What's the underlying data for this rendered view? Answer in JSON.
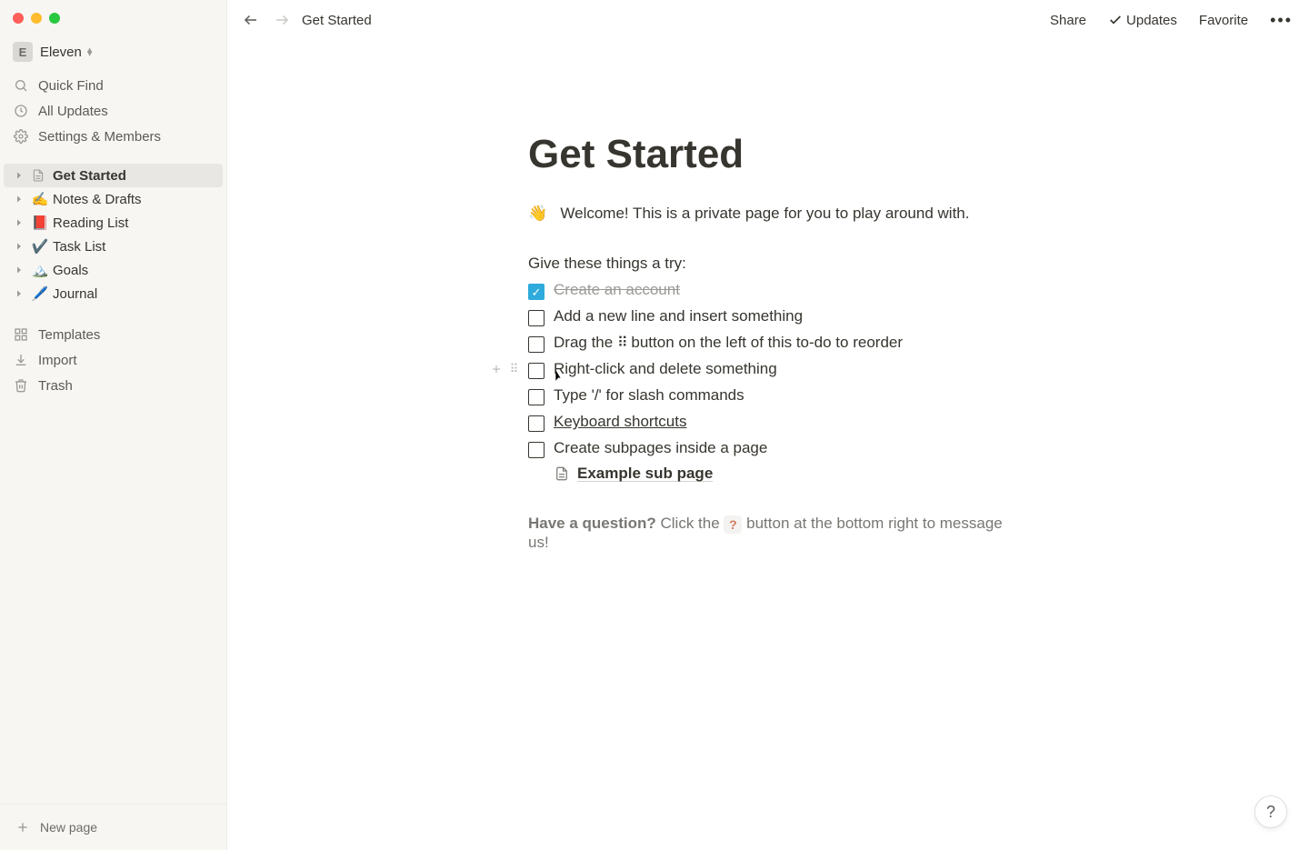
{
  "workspace": {
    "avatar_initial": "E",
    "name": "Eleven"
  },
  "nav": {
    "quick_find": "Quick Find",
    "all_updates": "All Updates",
    "settings_members": "Settings & Members",
    "templates": "Templates",
    "import": "Import",
    "trash": "Trash",
    "new_page": "New page"
  },
  "pages": [
    {
      "icon": "📄",
      "label": "Get Started",
      "active": true,
      "icon_type": "page"
    },
    {
      "icon": "✍️",
      "label": "Notes & Drafts"
    },
    {
      "icon": "📕",
      "label": "Reading List"
    },
    {
      "icon": "✔️",
      "label": "Task List"
    },
    {
      "icon": "🏔️",
      "label": "Goals"
    },
    {
      "icon": "🖊️",
      "label": "Journal"
    }
  ],
  "topbar": {
    "breadcrumb": "Get Started",
    "share": "Share",
    "updates": "Updates",
    "favorite": "Favorite"
  },
  "page": {
    "title": "Get Started",
    "welcome_emoji": "👋",
    "welcome_text": "Welcome! This is a private page for you to play around with.",
    "try_heading": "Give these things a try:",
    "todos": [
      {
        "text": "Create an account",
        "checked": true
      },
      {
        "text": "Add a new line and insert something",
        "checked": false
      },
      {
        "text_pre": "Drag the ",
        "handle": "⠿",
        "text_post": " button on the left of this to-do to reorder",
        "checked": false
      },
      {
        "text": "Right-click and delete something",
        "checked": false,
        "hovered": true
      },
      {
        "text": "Type '/' for slash commands",
        "checked": false
      },
      {
        "text": "Keyboard shortcuts",
        "checked": false,
        "underline": true
      },
      {
        "text": "Create subpages inside a page",
        "checked": false
      }
    ],
    "subpage": {
      "label": "Example sub page"
    },
    "footer": {
      "q_label": "Have a question?",
      "pre": " Click the ",
      "chip": "?",
      "post": " button at the bottom right to message us!"
    }
  }
}
